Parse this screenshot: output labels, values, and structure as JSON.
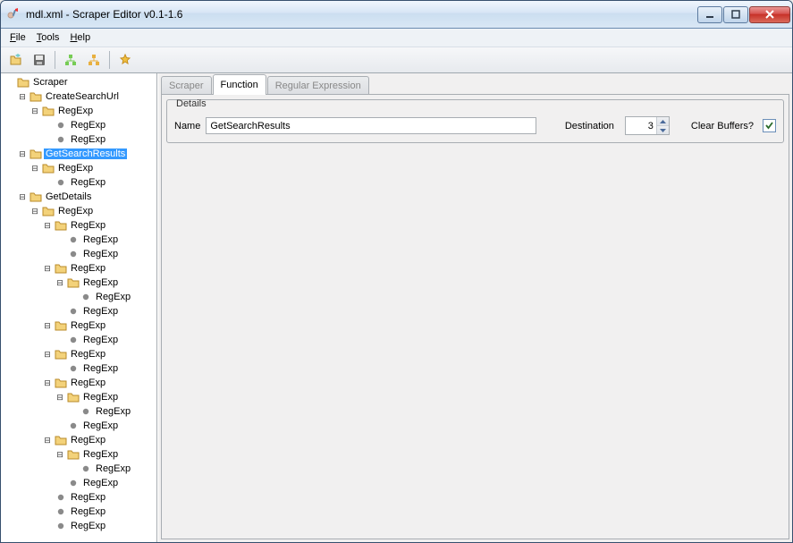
{
  "title": "mdl.xml - Scraper Editor v0.1-1.6",
  "menu": {
    "file": "File",
    "tools": "Tools",
    "help": "Help"
  },
  "tabs": {
    "scraper": "Scraper",
    "function": "Function",
    "regex": "Regular Expression"
  },
  "details": {
    "legend": "Details",
    "name_label": "Name",
    "name_value": "GetSearchResults",
    "destination_label": "Destination",
    "destination_value": "3",
    "clearbuffers_label": "Clear Buffers?",
    "clearbuffers_checked": true
  },
  "tree": {
    "root": "Scraper",
    "n0": "CreateSearchUrl",
    "n1": "GetSearchResults",
    "n2": "GetDetails",
    "regexp": "RegExp"
  }
}
